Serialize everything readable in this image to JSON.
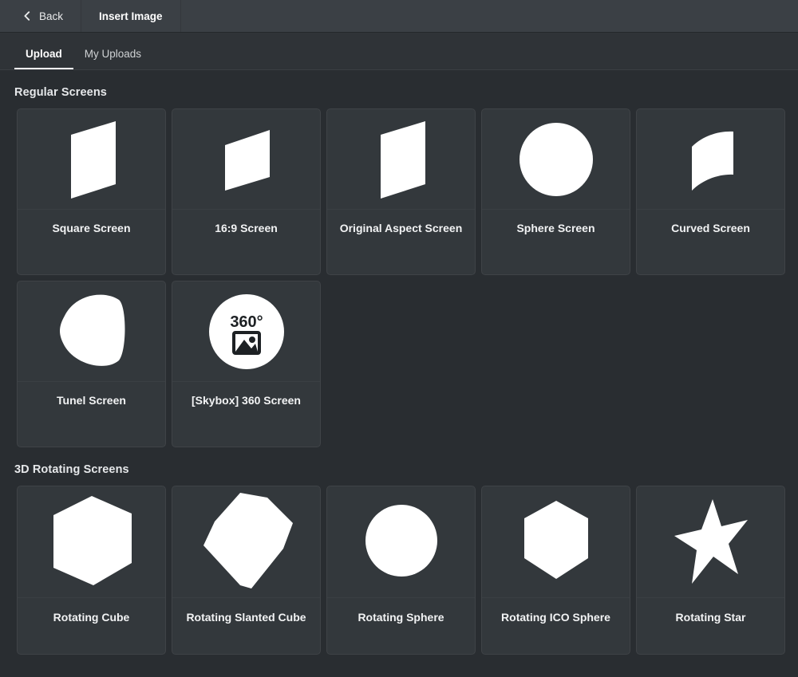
{
  "header": {
    "back_label": "Back",
    "back_icon": "chevron-left-icon",
    "title": "Insert Image"
  },
  "tabs": [
    {
      "label": "Upload",
      "active": true
    },
    {
      "label": "My Uploads",
      "active": false
    }
  ],
  "sections": [
    {
      "id": "regular-screens",
      "title": "Regular Screens",
      "cards": [
        {
          "label": "Square Screen",
          "icon": "perspective-square-screen-icon"
        },
        {
          "label": "16:9 Screen",
          "icon": "perspective-wide-screen-icon"
        },
        {
          "label": "Original Aspect Screen",
          "icon": "perspective-original-screen-icon"
        },
        {
          "label": "Sphere Screen",
          "icon": "circle-sphere-icon"
        },
        {
          "label": "Curved Screen",
          "icon": "curved-screen-icon"
        },
        {
          "label": "Tunel Screen",
          "icon": "tunnel-screen-icon"
        },
        {
          "label": "[Skybox] 360 Screen",
          "icon": "skybox-360-icon",
          "badge_text": "360°"
        }
      ]
    },
    {
      "id": "rotating-screens",
      "title": "3D Rotating Screens",
      "cards": [
        {
          "label": "Rotating Cube",
          "icon": "cube-icon"
        },
        {
          "label": "Rotating Slanted Cube",
          "icon": "slanted-cube-icon"
        },
        {
          "label": "Rotating Sphere",
          "icon": "sphere-icon"
        },
        {
          "label": "Rotating ICO Sphere",
          "icon": "ico-sphere-icon"
        },
        {
          "label": "Rotating Star",
          "icon": "star-icon"
        }
      ]
    }
  ],
  "colors": {
    "page_bg": "#292d31",
    "titlebar_bg": "#3b4045",
    "tabbar_bg": "#2f3337",
    "card_bg": "#33383c",
    "card_border": "#3f4347",
    "icon_fill": "#ffffff",
    "text_primary": "#f2f3f4",
    "accent": "#ffffff"
  }
}
